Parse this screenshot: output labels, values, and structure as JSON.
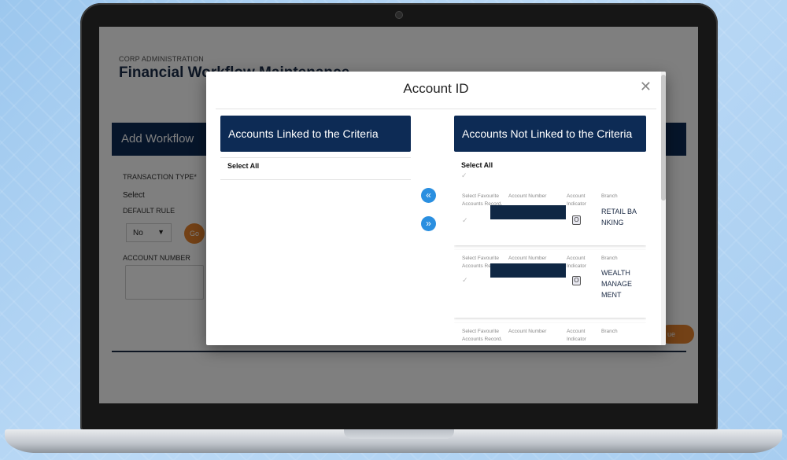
{
  "app": {
    "section_label": "CORP ADMINISTRATION",
    "page_title": "Financial Workflow Maintenance",
    "panel_title": "Add Workflow",
    "transaction_type_label": "TRANSACTION TYPE*",
    "transaction_type_value": "Select",
    "default_rule_label": "DEFAULT RULE",
    "default_rule_value": "No",
    "go_label": "Go",
    "account_number_label": "ACCOUNT NUMBER",
    "continue_label": "ue"
  },
  "modal": {
    "title": "Account ID",
    "close_icon": "close-icon",
    "linked": {
      "heading": "Accounts Linked to the Criteria",
      "select_all": "Select All"
    },
    "not_linked": {
      "heading": "Accounts Not Linked to the Criteria",
      "select_all": "Select All"
    },
    "move_left_icon": "«",
    "move_right_icon": "»",
    "account_columns": {
      "favourite": "Select Favourite Accounts Record.",
      "number": "Account Number",
      "indicator": "Account Indicator",
      "branch": "Branch"
    },
    "accounts": [
      {
        "indicator": "O",
        "branch": "RETAIL BANKING"
      },
      {
        "indicator": "O",
        "branch": "WEALTH MANAGEMENT"
      },
      {
        "indicator": "",
        "branch": ""
      }
    ]
  },
  "colors": {
    "navy": "#0d2b55",
    "accent_orange": "#e6822c",
    "arrow_blue": "#2a8fe0"
  }
}
